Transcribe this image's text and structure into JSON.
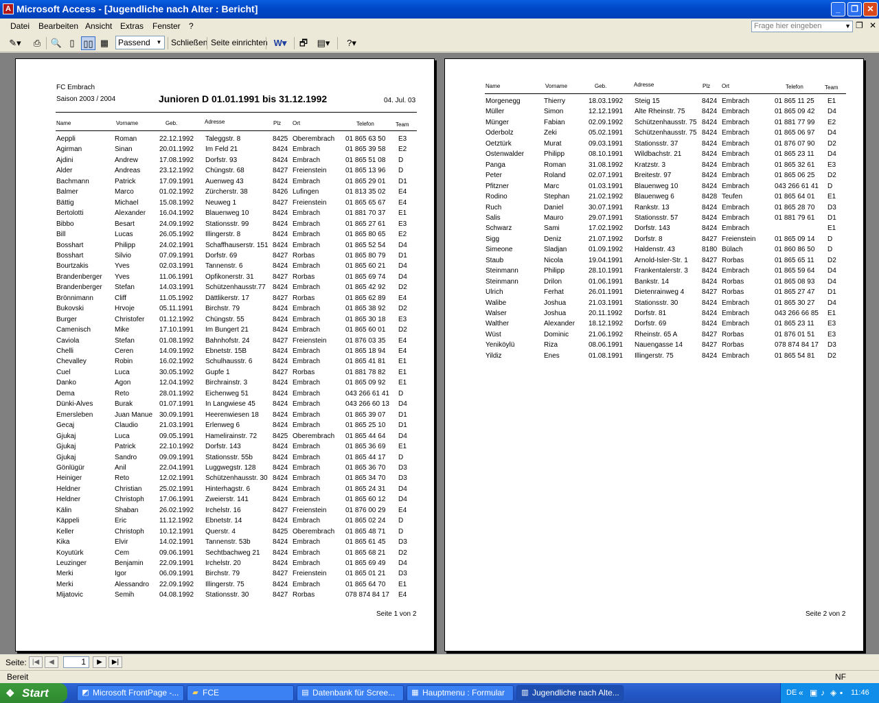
{
  "window": {
    "title": "Microsoft Access - [Jugendliche nach Alter : Bericht]",
    "app_icon": "access-key-icon"
  },
  "menu": {
    "items": [
      "Datei",
      "Bearbeiten",
      "Ansicht",
      "Extras",
      "Fenster",
      "?"
    ],
    "ask_placeholder": "Frage hier eingeben"
  },
  "toolbar": {
    "zoom_value": "Passend",
    "close_label": "Schließen",
    "page_setup_label": "Seite einrichten"
  },
  "report": {
    "club": "FC Embrach",
    "season": "Saison  2003 / 2004",
    "title": "Junioren D  01.01.1991 bis 31.12.1992",
    "date": "04. Jul. 03",
    "columns": [
      "Name",
      "Vorname",
      "Geb.",
      "Adresse",
      "Plz",
      "Ort",
      "Telefon",
      "Team"
    ],
    "page1_footer": "Seite 1 von 2",
    "page2_footer": "Seite 2 von 2",
    "page1_rows": [
      [
        "Aeppli",
        "Roman",
        "22.12.1992",
        "Taleggstr. 8",
        "8425",
        "Oberembrach",
        "01 865 63 50",
        "E3"
      ],
      [
        "Agirman",
        "Sinan",
        "20.01.1992",
        "Im Feld 21",
        "8424",
        "Embrach",
        "01 865 39 58",
        "E2"
      ],
      [
        "Ajdini",
        "Andrew",
        "17.08.1992",
        "Dorfstr. 93",
        "8424",
        "Embrach",
        "01 865 51 08",
        "D"
      ],
      [
        "Alder",
        "Andreas",
        "23.12.1992",
        "Chüngstr. 68",
        "8427",
        "Freienstein",
        "01 865 13 96",
        "D"
      ],
      [
        "Bachmann",
        "Patrick",
        "17.09.1991",
        "Auenweg 43",
        "8424",
        "Embrach",
        "01 865 29 01",
        "D1"
      ],
      [
        "Balmer",
        "Marco",
        "01.02.1992",
        "Zürcherstr. 38",
        "8426",
        "Lufingen",
        "01 813 35 02",
        "E4"
      ],
      [
        "Bättig",
        "Michael",
        "15.08.1992",
        "Neuweg 1",
        "8427",
        "Freienstein",
        "01 865 65 67",
        "E4"
      ],
      [
        "Bertolotti",
        "Alexander",
        "16.04.1992",
        "Blauenweg 10",
        "8424",
        "Embrach",
        "01 881 70 37",
        "E1"
      ],
      [
        "Bibbo",
        "Besart",
        "24.09.1992",
        "Stationsstr. 99",
        "8424",
        "Embrach",
        "01 865 27 61",
        "E3"
      ],
      [
        "Bill",
        "Lucas",
        "26.05.1992",
        "Illingerstr. 8",
        "8424",
        "Embrach",
        "01 865 80 65",
        "E2"
      ],
      [
        "Bosshart",
        "Philipp",
        "24.02.1991",
        "Schaffhauserstr. 151",
        "8424",
        "Embrach",
        "01 865 52 54",
        "D4"
      ],
      [
        "Bosshart",
        "Silvio",
        "07.09.1991",
        "Dorfstr. 69",
        "8427",
        "Rorbas",
        "01 865 80 79",
        "D1"
      ],
      [
        "Bourtzakis",
        "Yves",
        "02.03.1991",
        "Tannenstr. 6",
        "8424",
        "Embrach",
        "01 865 60 21",
        "D4"
      ],
      [
        "Brandenberger",
        "Yves",
        "11.06.1991",
        "Opfikonerstr. 31",
        "8427",
        "Rorbas",
        "01 865 69 74",
        "D4"
      ],
      [
        "Brandenberger",
        "Stefan",
        "14.03.1991",
        "Schützenhausstr.77",
        "8424",
        "Embrach",
        "01 865 42 92",
        "D2"
      ],
      [
        "Brönnimann",
        "Cliff",
        "11.05.1992",
        "Dättlikerstr. 17",
        "8427",
        "Rorbas",
        "01 865 62 89",
        "E4"
      ],
      [
        "Bukovski",
        "Hrvoje",
        "05.11.1991",
        "Birchstr. 79",
        "8424",
        "Embrach",
        "01 865 38 92",
        "D2"
      ],
      [
        "Burger",
        "Christofer",
        "01.12.1992",
        "Chüngstr. 55",
        "8424",
        "Embrach",
        "01 865 30 18",
        "E3"
      ],
      [
        "Camenisch",
        "Mike",
        "17.10.1991",
        "Im Bungert 21",
        "8424",
        "Embrach",
        "01 865 60 01",
        "D2"
      ],
      [
        "Caviola",
        "Stefan",
        "01.08.1992",
        "Bahnhofstr. 24",
        "8427",
        "Freienstein",
        "01 876 03 35",
        "E4"
      ],
      [
        "Chelli",
        "Ceren",
        "14.09.1992",
        "Ebnetstr. 15B",
        "8424",
        "Embrach",
        "01 865 18 94",
        "E4"
      ],
      [
        "Chevalley",
        "Robin",
        "16.02.1992",
        "Schulhausstr. 6",
        "8424",
        "Embrach",
        "01 865 41 81",
        "E1"
      ],
      [
        "Cuel",
        "Luca",
        "30.05.1992",
        "Gupfe 1",
        "8427",
        "Rorbas",
        "01 881 78 82",
        "E1"
      ],
      [
        "Danko",
        "Agon",
        "12.04.1992",
        "Birchrainstr. 3",
        "8424",
        "Embrach",
        "01 865 09 92",
        "E1"
      ],
      [
        "Dema",
        "Reto",
        "28.01.1992",
        "Eichenweg 51",
        "8424",
        "Embrach",
        "043 266 61 41",
        "D"
      ],
      [
        "Dünki-Alves",
        "Burak",
        "01.07.1991",
        "In Langwiese 45",
        "8424",
        "Embrach",
        "043 266 60 13",
        "D4"
      ],
      [
        "Emersleben",
        "Juan Manue",
        "30.09.1991",
        "Heerenwiesen 18",
        "8424",
        "Embrach",
        "01 865 39 07",
        "D1"
      ],
      [
        "Gecaj",
        "Claudio",
        "21.03.1991",
        "Erlenweg 6",
        "8424",
        "Embrach",
        "01 865 25 10",
        "D1"
      ],
      [
        "Gjukaj",
        "Luca",
        "09.05.1991",
        "Hamelirainstr. 72",
        "8425",
        "Oberembrach",
        "01 865 44 64",
        "D4"
      ],
      [
        "Gjukaj",
        "Patrick",
        "22.10.1992",
        "Dorfstr. 143",
        "8424",
        "Embrach",
        "01 865 36 69",
        "E1"
      ],
      [
        "Gjukaj",
        "Sandro",
        "09.09.1991",
        "Stationsstr. 55b",
        "8424",
        "Embrach",
        "01 865 44 17",
        "D"
      ],
      [
        "Gönlügür",
        "Anil",
        "22.04.1991",
        "Luggwegstr. 128",
        "8424",
        "Embrach",
        "01 865 36 70",
        "D3"
      ],
      [
        "Heiniger",
        "Reto",
        "12.02.1991",
        "Schützenhausstr. 30",
        "8424",
        "Embrach",
        "01 865 34 70",
        "D3"
      ],
      [
        "Heldner",
        "Christian",
        "25.02.1991",
        "Hinterhagstr. 6",
        "8424",
        "Embrach",
        "01 865 24 31",
        "D4"
      ],
      [
        "Heldner",
        "Christoph",
        "17.06.1991",
        "Zweierstr. 141",
        "8424",
        "Embrach",
        "01 865 60 12",
        "D4"
      ],
      [
        "Kälin",
        "Shaban",
        "26.02.1992",
        "Irchelstr. 16",
        "8427",
        "Freienstein",
        "01 876 00 29",
        "E4"
      ],
      [
        "Käppeli",
        "Eric",
        "11.12.1992",
        "Ebnetstr. 14",
        "8424",
        "Embrach",
        "01 865 02 24",
        "D"
      ],
      [
        "Keller",
        "Christoph",
        "10.12.1991",
        "Querstr. 4",
        "8425",
        "Oberembrach",
        "01 865 48 71",
        "D"
      ],
      [
        "Kika",
        "Elvir",
        "14.02.1991",
        "Tannenstr. 53b",
        "8424",
        "Embrach",
        "01 865 61 45",
        "D3"
      ],
      [
        "Koyutürk",
        "Cem",
        "09.06.1991",
        "Sechtbachweg 21",
        "8424",
        "Embrach",
        "01 865 68 21",
        "D2"
      ],
      [
        "Leuzinger",
        "Benjamin",
        "22.09.1991",
        "Irchelstr. 20",
        "8424",
        "Embrach",
        "01 865 69 49",
        "D4"
      ],
      [
        "Merki",
        "Igor",
        "06.09.1991",
        "Birchstr. 79",
        "8427",
        "Freienstein",
        "01 865 01 21",
        "D3"
      ],
      [
        "Merki",
        "Alessandro",
        "22.09.1992",
        "Illingerstr. 75",
        "8424",
        "Embrach",
        "01 865 64 70",
        "E1"
      ],
      [
        "Mijatovic",
        "Semih",
        "04.08.1992",
        "Stationsstr. 30",
        "8427",
        "Rorbas",
        "078 874 84 17",
        "E4"
      ]
    ],
    "page2_rows": [
      [
        "Morgenegg",
        "Thierry",
        "18.03.1992",
        "Steig 15",
        "8424",
        "Embrach",
        "01 865 11 25",
        "E1"
      ],
      [
        "Müller",
        "Simon",
        "12.12.1991",
        "Alte Rheinstr. 75",
        "8424",
        "Embrach",
        "01 865 09 42",
        "D4"
      ],
      [
        "Münger",
        "Fabian",
        "02.09.1992",
        "Schützenhausstr. 75",
        "8424",
        "Embrach",
        "01 881 77 99",
        "E2"
      ],
      [
        "Oderbolz",
        "Zeki",
        "05.02.1991",
        "Schützenhausstr. 75",
        "8424",
        "Embrach",
        "01 865 06 97",
        "D4"
      ],
      [
        "Oetztürk",
        "Murat",
        "09.03.1991",
        "Stationsstr. 37",
        "8424",
        "Embrach",
        "01 876 07 90",
        "D2"
      ],
      [
        "Ostenwalder",
        "Philipp",
        "08.10.1991",
        "Wildbachstr. 21",
        "8424",
        "Embrach",
        "01 865 23 11",
        "D4"
      ],
      [
        "Panga",
        "Roman",
        "31.08.1992",
        "Kratzstr. 3",
        "8424",
        "Embrach",
        "01 865 32 61",
        "E3"
      ],
      [
        "Peter",
        "Roland",
        "02.07.1991",
        "Breitestr. 97",
        "8424",
        "Embrach",
        "01 865 06 25",
        "D2"
      ],
      [
        "Pfitzner",
        "Marc",
        "01.03.1991",
        "Blauenweg 10",
        "8424",
        "Embrach",
        "043 266 61 41",
        "D"
      ],
      [
        "Rodino",
        "Stephan",
        "21.02.1992",
        "Blauenweg 6",
        "8428",
        "Teufen",
        "01 865 64 01",
        "E1"
      ],
      [
        "Ruch",
        "Daniel",
        "30.07.1991",
        "Rankstr. 13",
        "8424",
        "Embrach",
        "01 865 28 70",
        "D3"
      ],
      [
        "Salis",
        "Mauro",
        "29.07.1991",
        "Stationsstr. 57",
        "8424",
        "Embrach",
        "01 881 79 61",
        "D1"
      ],
      [
        "Schwarz",
        "Sami",
        "17.02.1992",
        "Dorfstr. 143",
        "8424",
        "Embrach",
        "",
        "E1"
      ],
      [
        "Sigg",
        "Deniz",
        "21.07.1992",
        "Dorfstr. 8",
        "8427",
        "Freienstein",
        "01 865 09 14",
        "D"
      ],
      [
        "Simeone",
        "Sladjan",
        "01.09.1992",
        "Haldenstr. 43",
        "8180",
        "Bülach",
        "01 860 86 50",
        "D"
      ],
      [
        "Staub",
        "Nicola",
        "19.04.1991",
        "Arnold-Isler-Str. 1",
        "8427",
        "Rorbas",
        "01 865 65 11",
        "D2"
      ],
      [
        "Steinmann",
        "Philipp",
        "28.10.1991",
        "Frankentalerstr. 3",
        "8424",
        "Embrach",
        "01 865 59 64",
        "D4"
      ],
      [
        "Steinmann",
        "Drilon",
        "01.06.1991",
        "Bankstr. 14",
        "8424",
        "Rorbas",
        "01 865 08 93",
        "D4"
      ],
      [
        "Ulrich",
        "Ferhat",
        "26.01.1991",
        "Dietenrainweg 4",
        "8427",
        "Rorbas",
        "01 865 27 47",
        "D1"
      ],
      [
        "Walibe",
        "Joshua",
        "21.03.1991",
        "Stationsstr. 30",
        "8424",
        "Embrach",
        "01 865 30 27",
        "D4"
      ],
      [
        "Walser",
        "Joshua",
        "20.11.1992",
        "Dorfstr. 81",
        "8424",
        "Embrach",
        "043 266 66 85",
        "E1"
      ],
      [
        "Walther",
        "Alexander",
        "18.12.1992",
        "Dorfstr. 69",
        "8424",
        "Embrach",
        "01 865 23 11",
        "E3"
      ],
      [
        "Wüst",
        "Dominic",
        "21.06.1992",
        "Rheinstr. 65 A",
        "8427",
        "Rorbas",
        "01 876 01 51",
        "E3"
      ],
      [
        "Yeniköylü",
        "Riza",
        "08.06.1991",
        "Nauengasse 14",
        "8427",
        "Rorbas",
        "078 874 84 17",
        "D3"
      ],
      [
        "Yildiz",
        "Enes",
        "01.08.1991",
        "Illingerstr. 75",
        "8424",
        "Embrach",
        "01 865 54 81",
        "D2"
      ]
    ]
  },
  "navigation": {
    "label": "Seite:",
    "current_page": "1"
  },
  "status": {
    "text": "Bereit",
    "indicator": "NF"
  },
  "taskbar": {
    "start_label": "Start",
    "tasks": [
      {
        "label": "Microsoft FrontPage -...",
        "icon": "frontpage-icon"
      },
      {
        "label": "FCE",
        "icon": "folder-icon"
      },
      {
        "label": "Datenbank für Scree...",
        "icon": "database-icon"
      },
      {
        "label": "Hauptmenu : Formular",
        "icon": "form-icon"
      },
      {
        "label": "Jugendliche nach Alte...",
        "icon": "report-icon"
      }
    ],
    "language": "DE",
    "clock": "11:46"
  }
}
